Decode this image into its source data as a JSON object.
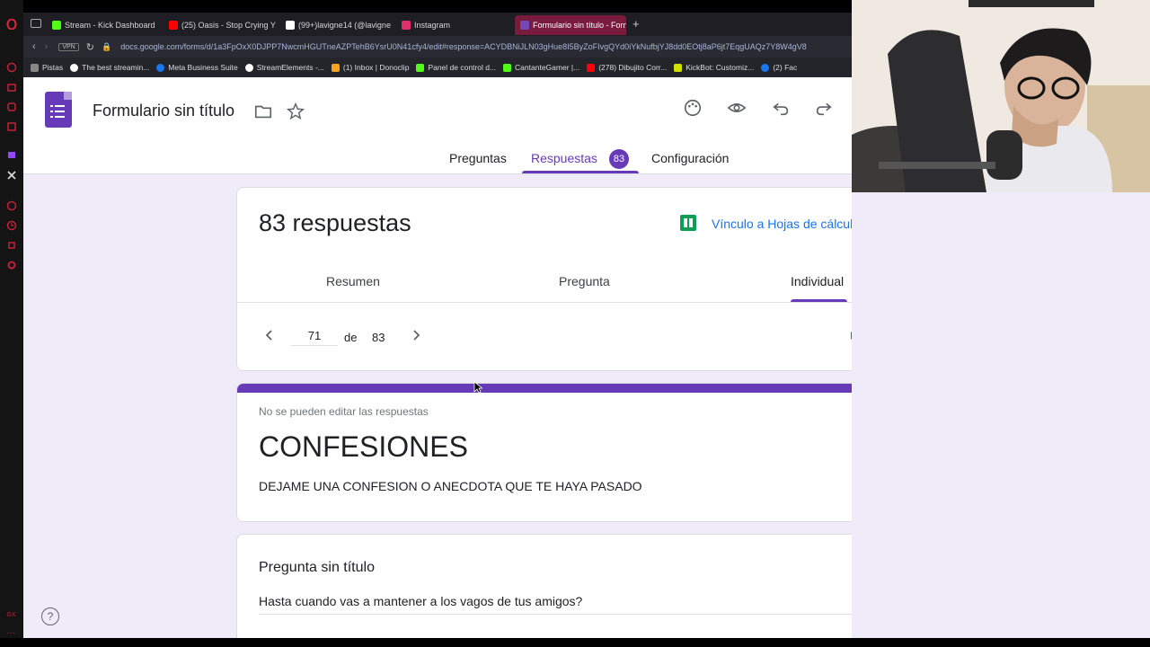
{
  "browser": {
    "tabs": [
      {
        "label": "Stream - Kick Dashboard",
        "color": "#53fc18"
      },
      {
        "label": "(25) Oasis - Stop Crying Y",
        "color": "#ff0000"
      },
      {
        "label": "(99+)lavigne14 (@lavigne",
        "color": "#ffffff"
      },
      {
        "label": "Instagram",
        "color": "#e1306c"
      },
      {
        "label": "Formulario sin título - Forn",
        "color": "#7248b9"
      }
    ],
    "url": "docs.google.com/forms/d/1a3FpOxX0DJPP7NwcmHGUTneAZPTehB6YsrU0N41cfy4/edit#response=ACYDBNiJLN03gHue8I5ByZoFIvgQYd0iYkNufbjYJ8dd0EOtj8aP6jt7EqgUAQz7Y8W4gV8",
    "vpn_label": "VPN",
    "bookmarks": [
      {
        "label": "Pistas",
        "color": "#888888"
      },
      {
        "label": "The best streamin...",
        "color": "#ffffff"
      },
      {
        "label": "Meta Business Suite",
        "color": "#1877f2"
      },
      {
        "label": "StreamElements -...",
        "color": "#ffffff"
      },
      {
        "label": "(1) Inbox | Donoclip",
        "color": "#f7a21b"
      },
      {
        "label": "Panel de control d...",
        "color": "#53fc18"
      },
      {
        "label": "CantanteGamer |...",
        "color": "#53fc18"
      },
      {
        "label": "(278) Dibujito Corr...",
        "color": "#ff0000"
      },
      {
        "label": "KickBot: Customiz...",
        "color": "#d4e000"
      },
      {
        "label": "(2) Fac",
        "color": "#1877f2"
      }
    ]
  },
  "forms": {
    "doc_title": "Formulario sin título",
    "tabs": {
      "questions": "Preguntas",
      "responses": "Respuestas",
      "responses_count": "83",
      "settings": "Configuración"
    },
    "responses": {
      "count_label": "83 respuestas",
      "sheets_link": "Vínculo a Hojas de cálculo",
      "subtabs": {
        "summary": "Resumen",
        "question": "Pregunta",
        "individual": "Individual"
      },
      "current": "71",
      "of_label": "de",
      "total": "83"
    },
    "form": {
      "note": "No se pueden editar las respuestas",
      "title": "CONFESIONES",
      "description": "DEJAME UNA CONFESION O ANECDOTA QUE TE HAYA PASADO"
    },
    "question": {
      "title": "Pregunta sin título",
      "answer": "Hasta cuando vas a mantener a los vagos de tus amigos?"
    },
    "help_label": "?",
    "accent": "#673ab7"
  }
}
